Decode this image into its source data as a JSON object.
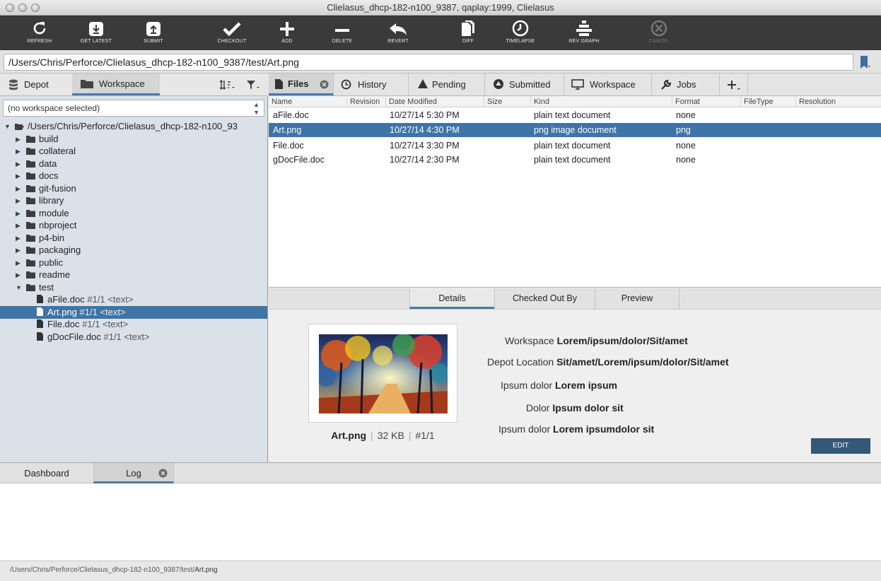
{
  "window": {
    "title": "Clielasus_dhcp-182-n100_9387,  qaplay:1999,  Clielasus"
  },
  "toolbar": {
    "refresh": "REFRESH",
    "get_latest": "GET LATEST",
    "submit": "SUBMIT",
    "checkout": "CHECKOUT",
    "add": "ADD",
    "delete": "DELETE",
    "revert": "REVERT",
    "diff": "DIFF",
    "timelapse": "TIMELAPSE",
    "rev_graph": "REV GRAPH",
    "cancel": "CANCEL"
  },
  "path": {
    "prefix": "/Users/Chris/Perforce/Clielasus_dhcp-182-n100_9387/test/",
    "file": "Art.png"
  },
  "left": {
    "tabs": {
      "depot": "Depot",
      "workspace": "Workspace"
    },
    "workspace_select": "(no workspace selected)",
    "root": "/Users/Chris/Perforce/Clielasus_dhcp-182-n100_93",
    "folders": [
      "build",
      "collateral",
      "data",
      "docs",
      "git-fusion",
      "library",
      "module",
      "nbproject",
      "p4-bin",
      "packaging",
      "public",
      "readme",
      "test"
    ],
    "files": [
      {
        "name": "aFile.doc",
        "rev": "#1/1 <text>"
      },
      {
        "name": "Art.png",
        "rev": "#1/1 <text>"
      },
      {
        "name": "File.doc",
        "rev": "#1/1 <text>"
      },
      {
        "name": "gDocFile.doc",
        "rev": "#1/1 <text>"
      }
    ]
  },
  "right": {
    "tabs": [
      "Files",
      "History",
      "Pending",
      "Submitted",
      "Workspace",
      "Jobs"
    ],
    "columns": [
      "Name",
      "Revision",
      "Date Modified",
      "Size",
      "Kind",
      "Format",
      "FileType",
      "Resolution"
    ],
    "rows": [
      {
        "name": "aFile.doc",
        "date": "10/27/14 5:30 PM",
        "kind": "plain text document",
        "format": "none"
      },
      {
        "name": "Art.png",
        "date": "10/27/14 4:30 PM",
        "kind": "png image document",
        "format": "png"
      },
      {
        "name": "File.doc",
        "date": "10/27/14 3:30 PM",
        "kind": "plain text document",
        "format": "none"
      },
      {
        "name": "gDocFile.doc",
        "date": "10/27/14 2:30 PM",
        "kind": "plain text document",
        "format": "none"
      }
    ]
  },
  "details": {
    "tabs": [
      "Details",
      "Checked Out By",
      "Preview"
    ],
    "caption": {
      "name": "Art.png",
      "size": "32 KB",
      "rev": "#1/1"
    },
    "props": [
      {
        "label": "Workspace",
        "value": "Lorem/ipsum/dolor/Sit/amet"
      },
      {
        "label": "Depot Location",
        "value": "Sit/amet/Lorem/ipsum/dolor/Sit/amet"
      },
      {
        "label": "Ipsum dolor",
        "value": "Lorem ipsum"
      },
      {
        "label": "Dolor",
        "value": "Ipsum dolor sit"
      },
      {
        "label": "Ipsum dolor",
        "value": "Lorem ipsumdolor sit"
      }
    ],
    "edit_button": "EDIT"
  },
  "bottom": {
    "tabs": [
      "Dashboard",
      "Log"
    ]
  },
  "status": {
    "prefix": "/Users/Chris/Perforce/Clielasus_dhcp-182-n100_9387/test/",
    "file": "Art.png"
  },
  "colors": {
    "toolbar_bg": "#3a3a3a",
    "selection": "#3e74a6",
    "tab_underline": "#4a7aa8",
    "left_panel_bg": "#dbe1e9",
    "edit_button": "#345878"
  }
}
